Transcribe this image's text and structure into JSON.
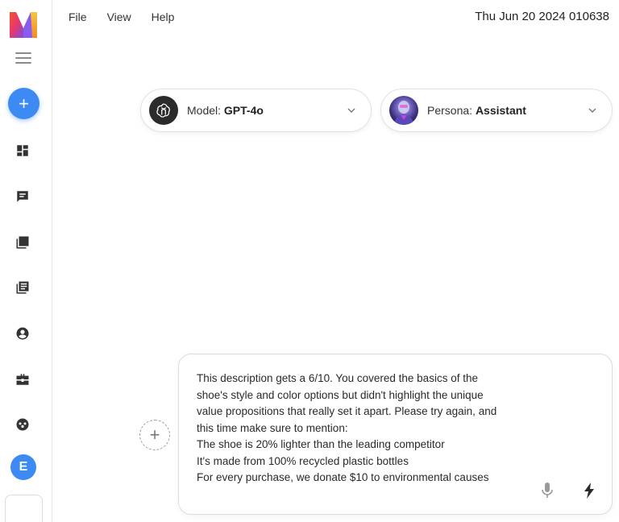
{
  "menu": {
    "file": "File",
    "view": "View",
    "help": "Help"
  },
  "datetime": "Thu Jun 20 2024 010638",
  "sidebar": {
    "new_label": "+",
    "items": [
      {
        "icon": "dashboard-icon"
      },
      {
        "icon": "chat-icon"
      },
      {
        "icon": "images-icon"
      },
      {
        "icon": "library-icon"
      },
      {
        "icon": "account-icon"
      },
      {
        "icon": "briefcase-icon"
      },
      {
        "icon": "community-icon"
      }
    ],
    "user_initial": "E"
  },
  "model_selector": {
    "label": "Model:",
    "value": "GPT-4o",
    "icon": "openai-logo-icon"
  },
  "persona_selector": {
    "label": "Persona:",
    "value": "Assistant",
    "icon": "persona-avatar"
  },
  "composer": {
    "lines": [
      "This description gets a 6/10. You covered the basics of the",
      "shoe's style and color options but didn't highlight the unique",
      "value propositions that really set it apart. Please try again, and",
      "this time make sure to mention:",
      "The shoe is 20% lighter than the leading competitor",
      "It's made from 100% recycled plastic bottles",
      "For every purchase, we donate $10 to environmental causes"
    ],
    "add_label": "+"
  },
  "colors": {
    "accent": "#3d8bf2",
    "border": "#e2e2e2",
    "text": "#222222"
  }
}
